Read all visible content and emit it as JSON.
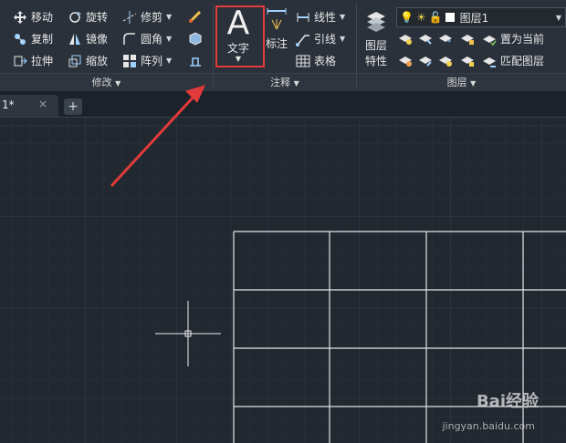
{
  "ribbon": {
    "modify": {
      "title": "修改",
      "col1": [
        "移动",
        "复制",
        "拉伸"
      ],
      "col2": [
        "旋转",
        "镜像",
        "缩放"
      ],
      "col3": [
        "修剪",
        "圆角",
        "阵列"
      ]
    },
    "annotation": {
      "title": "注释",
      "text_btn": "文字",
      "text_glyph": "A",
      "dim_btn": "标注",
      "col": [
        "线性",
        "引线",
        "表格"
      ]
    },
    "layers": {
      "title": "图层",
      "props_line1": "图层",
      "props_line2": "特性",
      "current_layer": "图层1",
      "actions": [
        "置为当前",
        "匹配图层"
      ]
    }
  },
  "tabs": [
    {
      "label": "1*",
      "close": "×"
    }
  ],
  "new_tab": "+",
  "watermark": {
    "brand": "Bai经验",
    "url": "jingyan.baidu.com"
  },
  "colors": {
    "highlight": "#e23b3b",
    "arrow": "#e23b3b",
    "background": "#212830"
  }
}
